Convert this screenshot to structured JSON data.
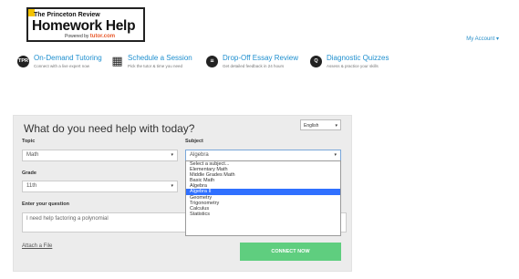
{
  "logo": {
    "brand_top": "The Princeton Review",
    "brand_main": "Homework Help",
    "powered_prefix": "Powered by",
    "powered_brand": "tutor.com"
  },
  "account": {
    "label": "My Account ▾"
  },
  "services": [
    {
      "icon": "tutor-badge-icon",
      "icon_text": "TPR",
      "title": "On-Demand Tutoring",
      "desc": "Connect with a live expert now"
    },
    {
      "icon": "calendar-icon",
      "icon_text": "▦",
      "title": "Schedule a Session",
      "desc": "Pick the tutor & time you need"
    },
    {
      "icon": "essay-icon",
      "icon_text": "≡",
      "title": "Drop-Off Essay Review",
      "desc": "Get detailed feedback in 24 hours"
    },
    {
      "icon": "quiz-icon",
      "icon_text": "Q",
      "title": "Diagnostic Quizzes",
      "desc": "Assess & practice your skills"
    }
  ],
  "form": {
    "heading": "What do you need help with today?",
    "language": "English",
    "topic_label": "Topic",
    "topic_value": "Math",
    "subject_label": "Subject",
    "subject_value": "Algebra",
    "grade_label": "Grade",
    "grade_value": "11th",
    "question_label": "Enter your question",
    "question_value": "I need help factoring a polynomial",
    "attach_label": "Attach a File",
    "connect_label": "CONNECT NOW"
  },
  "subject_options": [
    "Select a subject...",
    "Elementary Math",
    "Middle Grades Math",
    "Basic Math",
    "Algebra",
    "Algebra II",
    "Geometry",
    "Trigonometry",
    "Calculus",
    "Statistics"
  ],
  "subject_highlighted": "Algebra II",
  "colors": {
    "link_blue": "#1e8fcf",
    "accent_yellow": "#f2c200",
    "powered_orange": "#e8582a",
    "connect_green": "#5fce7f",
    "highlight_blue": "#3070ff",
    "panel_bg": "#ececec"
  }
}
